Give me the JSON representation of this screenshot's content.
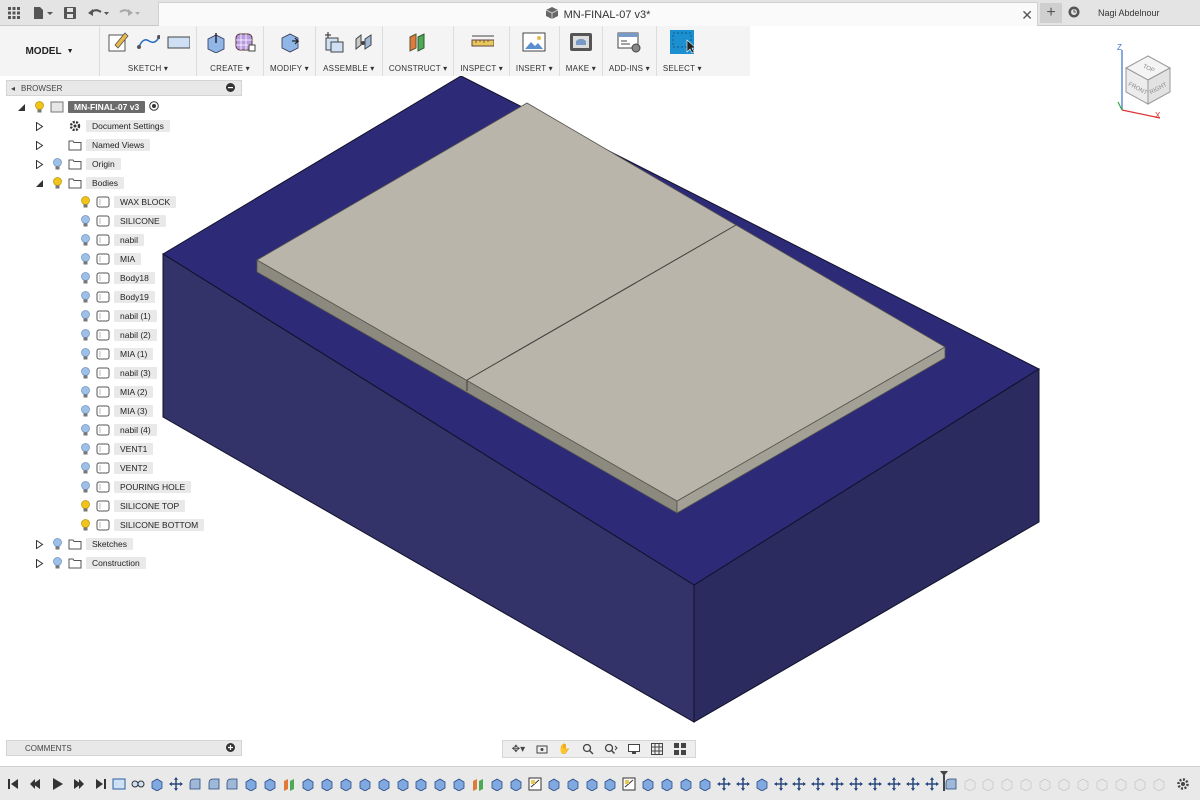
{
  "app": {
    "doc_title": "MN-FINAL-07 v3*",
    "user_name": "Nagi Abdelnour"
  },
  "toolbar": {
    "workspace": "MODEL",
    "groups": [
      {
        "label": "SKETCH"
      },
      {
        "label": "CREATE"
      },
      {
        "label": "MODIFY"
      },
      {
        "label": "ASSEMBLE"
      },
      {
        "label": "CONSTRUCT"
      },
      {
        "label": "INSPECT"
      },
      {
        "label": "INSERT"
      },
      {
        "label": "MAKE"
      },
      {
        "label": "ADD-INS"
      },
      {
        "label": "SELECT"
      }
    ]
  },
  "browser": {
    "header": "BROWSER",
    "root": "MN-FINAL-07 v3",
    "top_items": [
      "Document Settings",
      "Named Views",
      "Origin",
      "Bodies"
    ],
    "bodies": [
      "WAX BLOCK",
      "SILICONE",
      "nabil",
      "MIA",
      "Body18",
      "Body19",
      "nabil (1)",
      "nabil (2)",
      "MIA (1)",
      "nabil (3)",
      "MIA (2)",
      "MIA (3)",
      "nabil (4)",
      "VENT1",
      "VENT2",
      "POURING HOLE",
      "SILICONE TOP",
      "SILICONE BOTTOM"
    ],
    "bottom_items": [
      "Sketches",
      "Construction"
    ]
  },
  "comments": {
    "header": "COMMENTS"
  },
  "viewcube": {
    "top": "TOP",
    "front": "FRONT",
    "right": "RIGHT",
    "axis_z": "Z",
    "axis_x": "X"
  },
  "colors": {
    "block_top": "#2d2b78",
    "block_front": "#34346a",
    "block_side": "#2a2a5e",
    "slab": "#b9b5aa",
    "slab_edge": "#8c897f",
    "select_accent": "#1c8fd0"
  }
}
